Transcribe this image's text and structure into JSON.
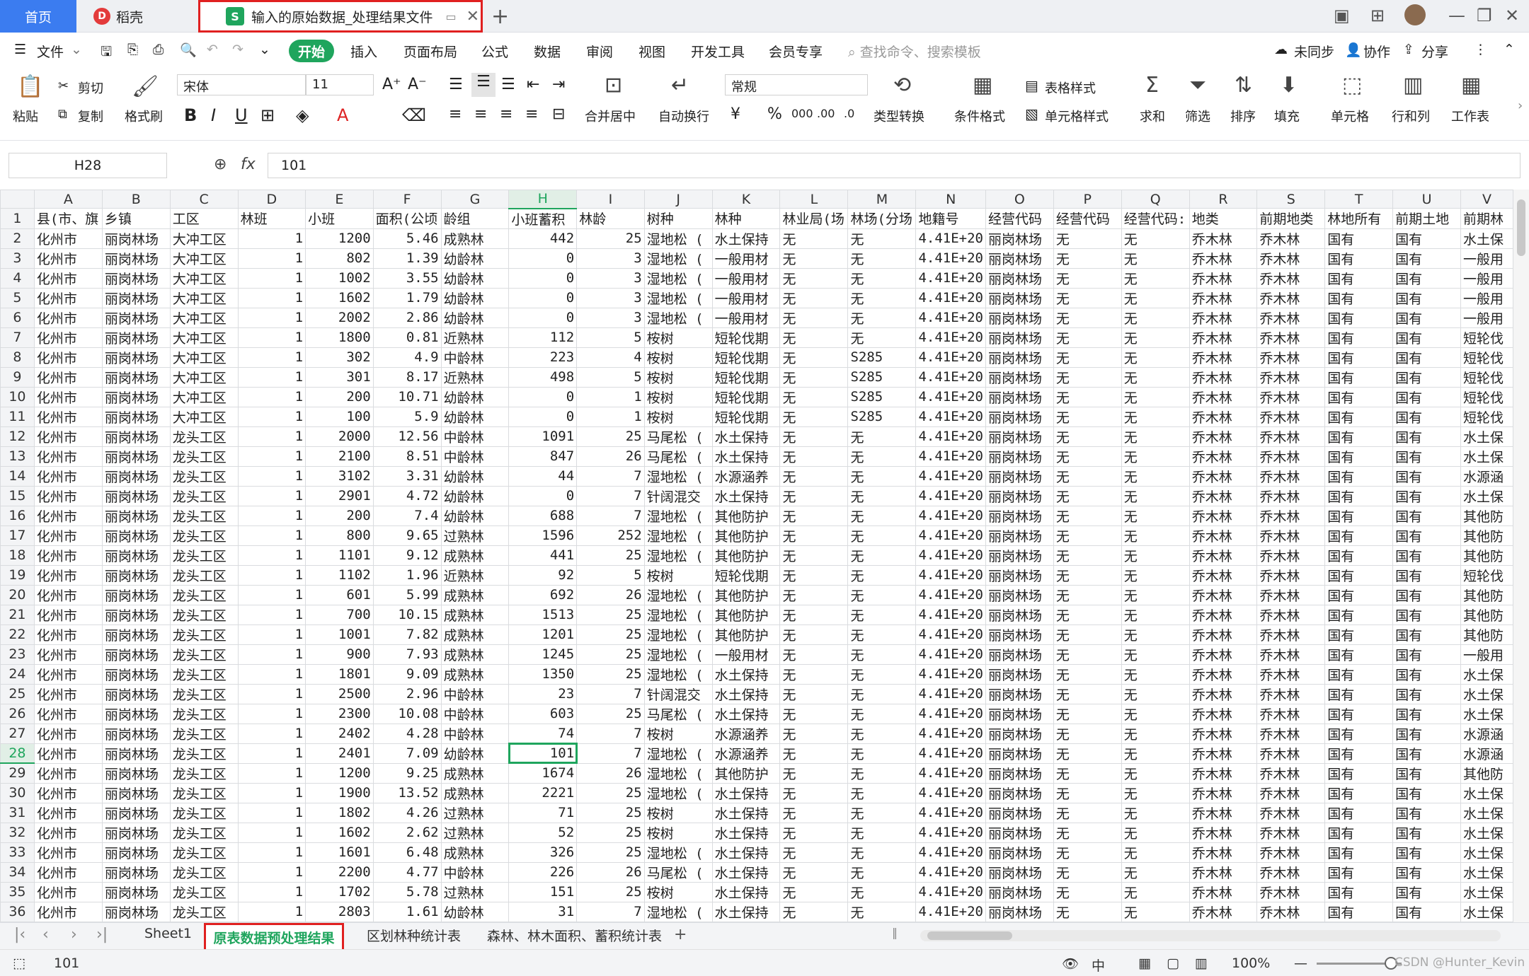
{
  "titlebar": {
    "home": "首页",
    "dk": "稻壳",
    "dk_logo": "D",
    "file_tab": "输入的原始数据_处理结果文件",
    "file_icon": "S",
    "add": "+",
    "pin_icon": "▭",
    "close_icon": "✕"
  },
  "menubar": {
    "file": "文件",
    "items": [
      "开始",
      "插入",
      "页面布局",
      "公式",
      "数据",
      "审阅",
      "视图",
      "开发工具",
      "会员专享"
    ],
    "search": "查找命令、搜索模板",
    "unsync": "未同步",
    "collab": "协作",
    "share": "分享"
  },
  "ribbon": {
    "paste": "粘贴",
    "cut": "剪切",
    "copy": "复制",
    "format_painter": "格式刷",
    "font_name": "宋体",
    "font_size": "11",
    "bold": "B",
    "italic": "I",
    "underline": "U",
    "merge": "合并居中",
    "wrap": "自动换行",
    "number_format": "常规",
    "currency": "¥",
    "percent": "%",
    "thousand": "000",
    "type_convert": "类型转换",
    "cond_format": "条件格式",
    "table_style": "表格样式",
    "cell_style": "单元格样式",
    "sum": "求和",
    "filter": "筛选",
    "sort": "排序",
    "fill": "填充",
    "cell": "单元格",
    "rowcol": "行和列",
    "worksheet": "工作表"
  },
  "formula": {
    "cell_ref": "H28",
    "fx": "fx",
    "value": "101"
  },
  "grid": {
    "columns": [
      "A",
      "B",
      "C",
      "D",
      "E",
      "F",
      "G",
      "H",
      "I",
      "J",
      "K",
      "L",
      "M",
      "N",
      "O",
      "P",
      "Q",
      "R",
      "S",
      "T",
      "U",
      "V"
    ],
    "selected_col": "H",
    "selected_row": "28",
    "header_row": [
      "县(市、旗",
      "乡镇",
      "工区",
      "林班",
      "小班",
      "面积(公顷",
      "龄组",
      "小班蓄积",
      "林龄",
      "树种",
      "林种",
      "林业局(场",
      "林场(分场",
      "地籍号",
      "经营代码",
      "经营代码",
      "经营代码:",
      "地类",
      "前期地类",
      "林地所有",
      "前期土地",
      "前期林"
    ],
    "rows": [
      [
        "2",
        "化州市",
        "丽岗林场",
        "大冲工区",
        "1",
        "1200",
        "5.46",
        "成熟林",
        "442",
        "25",
        "湿地松 (",
        "水土保持",
        "无",
        "无",
        "4.41E+20",
        "丽岗林场",
        "无",
        "无",
        "乔木林",
        "乔木林",
        "国有",
        "国有",
        "水土保"
      ],
      [
        "3",
        "化州市",
        "丽岗林场",
        "大冲工区",
        "1",
        "802",
        "1.39",
        "幼龄林",
        "0",
        "3",
        "湿地松 (",
        "一般用材",
        "无",
        "无",
        "4.41E+20",
        "丽岗林场",
        "无",
        "无",
        "乔木林",
        "乔木林",
        "国有",
        "国有",
        "一般用"
      ],
      [
        "4",
        "化州市",
        "丽岗林场",
        "大冲工区",
        "1",
        "1002",
        "3.55",
        "幼龄林",
        "0",
        "3",
        "湿地松 (",
        "一般用材",
        "无",
        "无",
        "4.41E+20",
        "丽岗林场",
        "无",
        "无",
        "乔木林",
        "乔木林",
        "国有",
        "国有",
        "一般用"
      ],
      [
        "5",
        "化州市",
        "丽岗林场",
        "大冲工区",
        "1",
        "1602",
        "1.79",
        "幼龄林",
        "0",
        "3",
        "湿地松 (",
        "一般用材",
        "无",
        "无",
        "4.41E+20",
        "丽岗林场",
        "无",
        "无",
        "乔木林",
        "乔木林",
        "国有",
        "国有",
        "一般用"
      ],
      [
        "6",
        "化州市",
        "丽岗林场",
        "大冲工区",
        "1",
        "2002",
        "2.86",
        "幼龄林",
        "0",
        "3",
        "湿地松 (",
        "一般用材",
        "无",
        "无",
        "4.41E+20",
        "丽岗林场",
        "无",
        "无",
        "乔木林",
        "乔木林",
        "国有",
        "国有",
        "一般用"
      ],
      [
        "7",
        "化州市",
        "丽岗林场",
        "大冲工区",
        "1",
        "1800",
        "0.81",
        "近熟林",
        "112",
        "5",
        "桉树",
        "短轮伐期",
        "无",
        "无",
        "4.41E+20",
        "丽岗林场",
        "无",
        "无",
        "乔木林",
        "乔木林",
        "国有",
        "国有",
        "短轮伐"
      ],
      [
        "8",
        "化州市",
        "丽岗林场",
        "大冲工区",
        "1",
        "302",
        "4.9",
        "中龄林",
        "223",
        "4",
        "桉树",
        "短轮伐期",
        "无",
        "S285",
        "4.41E+20",
        "丽岗林场",
        "无",
        "无",
        "乔木林",
        "乔木林",
        "国有",
        "国有",
        "短轮伐"
      ],
      [
        "9",
        "化州市",
        "丽岗林场",
        "大冲工区",
        "1",
        "301",
        "8.17",
        "近熟林",
        "498",
        "5",
        "桉树",
        "短轮伐期",
        "无",
        "S285",
        "4.41E+20",
        "丽岗林场",
        "无",
        "无",
        "乔木林",
        "乔木林",
        "国有",
        "国有",
        "短轮伐"
      ],
      [
        "10",
        "化州市",
        "丽岗林场",
        "大冲工区",
        "1",
        "200",
        "10.71",
        "幼龄林",
        "0",
        "1",
        "桉树",
        "短轮伐期",
        "无",
        "S285",
        "4.41E+20",
        "丽岗林场",
        "无",
        "无",
        "乔木林",
        "乔木林",
        "国有",
        "国有",
        "短轮伐"
      ],
      [
        "11",
        "化州市",
        "丽岗林场",
        "大冲工区",
        "1",
        "100",
        "5.9",
        "幼龄林",
        "0",
        "1",
        "桉树",
        "短轮伐期",
        "无",
        "S285",
        "4.41E+20",
        "丽岗林场",
        "无",
        "无",
        "乔木林",
        "乔木林",
        "国有",
        "国有",
        "短轮伐"
      ],
      [
        "12",
        "化州市",
        "丽岗林场",
        "龙头工区",
        "1",
        "2000",
        "12.56",
        "中龄林",
        "1091",
        "25",
        "马尾松 (",
        "水土保持",
        "无",
        "无",
        "4.41E+20",
        "丽岗林场",
        "无",
        "无",
        "乔木林",
        "乔木林",
        "国有",
        "国有",
        "水土保"
      ],
      [
        "13",
        "化州市",
        "丽岗林场",
        "龙头工区",
        "1",
        "2100",
        "8.51",
        "中龄林",
        "847",
        "26",
        "马尾松 (",
        "水土保持",
        "无",
        "无",
        "4.41E+20",
        "丽岗林场",
        "无",
        "无",
        "乔木林",
        "乔木林",
        "国有",
        "国有",
        "水土保"
      ],
      [
        "14",
        "化州市",
        "丽岗林场",
        "龙头工区",
        "1",
        "3102",
        "3.31",
        "幼龄林",
        "44",
        "7",
        "湿地松 (",
        "水源涵养",
        "无",
        "无",
        "4.41E+20",
        "丽岗林场",
        "无",
        "无",
        "乔木林",
        "乔木林",
        "国有",
        "国有",
        "水源涵"
      ],
      [
        "15",
        "化州市",
        "丽岗林场",
        "龙头工区",
        "1",
        "2901",
        "4.72",
        "幼龄林",
        "0",
        "7",
        "针阔混交",
        "水土保持",
        "无",
        "无",
        "4.41E+20",
        "丽岗林场",
        "无",
        "无",
        "乔木林",
        "乔木林",
        "国有",
        "国有",
        "水土保"
      ],
      [
        "16",
        "化州市",
        "丽岗林场",
        "龙头工区",
        "1",
        "200",
        "7.4",
        "幼龄林",
        "688",
        "7",
        "湿地松 (",
        "其他防护",
        "无",
        "无",
        "4.41E+20",
        "丽岗林场",
        "无",
        "无",
        "乔木林",
        "乔木林",
        "国有",
        "国有",
        "其他防"
      ],
      [
        "17",
        "化州市",
        "丽岗林场",
        "龙头工区",
        "1",
        "800",
        "9.65",
        "过熟林",
        "1596",
        "252",
        "湿地松 (",
        "其他防护",
        "无",
        "无",
        "4.41E+20",
        "丽岗林场",
        "无",
        "无",
        "乔木林",
        "乔木林",
        "国有",
        "国有",
        "其他防"
      ],
      [
        "18",
        "化州市",
        "丽岗林场",
        "龙头工区",
        "1",
        "1101",
        "9.12",
        "成熟林",
        "441",
        "25",
        "湿地松 (",
        "其他防护",
        "无",
        "无",
        "4.41E+20",
        "丽岗林场",
        "无",
        "无",
        "乔木林",
        "乔木林",
        "国有",
        "国有",
        "其他防"
      ],
      [
        "19",
        "化州市",
        "丽岗林场",
        "龙头工区",
        "1",
        "1102",
        "1.96",
        "近熟林",
        "92",
        "5",
        "桉树",
        "短轮伐期",
        "无",
        "无",
        "4.41E+20",
        "丽岗林场",
        "无",
        "无",
        "乔木林",
        "乔木林",
        "国有",
        "国有",
        "短轮伐"
      ],
      [
        "20",
        "化州市",
        "丽岗林场",
        "龙头工区",
        "1",
        "601",
        "5.99",
        "成熟林",
        "692",
        "26",
        "湿地松 (",
        "其他防护",
        "无",
        "无",
        "4.41E+20",
        "丽岗林场",
        "无",
        "无",
        "乔木林",
        "乔木林",
        "国有",
        "国有",
        "其他防"
      ],
      [
        "21",
        "化州市",
        "丽岗林场",
        "龙头工区",
        "1",
        "700",
        "10.15",
        "成熟林",
        "1513",
        "25",
        "湿地松 (",
        "其他防护",
        "无",
        "无",
        "4.41E+20",
        "丽岗林场",
        "无",
        "无",
        "乔木林",
        "乔木林",
        "国有",
        "国有",
        "其他防"
      ],
      [
        "22",
        "化州市",
        "丽岗林场",
        "龙头工区",
        "1",
        "1001",
        "7.82",
        "成熟林",
        "1201",
        "25",
        "湿地松 (",
        "其他防护",
        "无",
        "无",
        "4.41E+20",
        "丽岗林场",
        "无",
        "无",
        "乔木林",
        "乔木林",
        "国有",
        "国有",
        "其他防"
      ],
      [
        "23",
        "化州市",
        "丽岗林场",
        "龙头工区",
        "1",
        "900",
        "7.93",
        "成熟林",
        "1245",
        "25",
        "湿地松 (",
        "一般用材",
        "无",
        "无",
        "4.41E+20",
        "丽岗林场",
        "无",
        "无",
        "乔木林",
        "乔木林",
        "国有",
        "国有",
        "一般用"
      ],
      [
        "24",
        "化州市",
        "丽岗林场",
        "龙头工区",
        "1",
        "1801",
        "9.09",
        "成熟林",
        "1350",
        "25",
        "湿地松 (",
        "水土保持",
        "无",
        "无",
        "4.41E+20",
        "丽岗林场",
        "无",
        "无",
        "乔木林",
        "乔木林",
        "国有",
        "国有",
        "水土保"
      ],
      [
        "25",
        "化州市",
        "丽岗林场",
        "龙头工区",
        "1",
        "2500",
        "2.96",
        "中龄林",
        "23",
        "7",
        "针阔混交",
        "水土保持",
        "无",
        "无",
        "4.41E+20",
        "丽岗林场",
        "无",
        "无",
        "乔木林",
        "乔木林",
        "国有",
        "国有",
        "水土保"
      ],
      [
        "26",
        "化州市",
        "丽岗林场",
        "龙头工区",
        "1",
        "2300",
        "10.08",
        "中龄林",
        "603",
        "25",
        "马尾松 (",
        "水土保持",
        "无",
        "无",
        "4.41E+20",
        "丽岗林场",
        "无",
        "无",
        "乔木林",
        "乔木林",
        "国有",
        "国有",
        "水土保"
      ],
      [
        "27",
        "化州市",
        "丽岗林场",
        "龙头工区",
        "1",
        "2402",
        "4.28",
        "中龄林",
        "74",
        "7",
        "桉树",
        "水源涵养",
        "无",
        "无",
        "4.41E+20",
        "丽岗林场",
        "无",
        "无",
        "乔木林",
        "乔木林",
        "国有",
        "国有",
        "水源涵"
      ],
      [
        "28",
        "化州市",
        "丽岗林场",
        "龙头工区",
        "1",
        "2401",
        "7.09",
        "幼龄林",
        "101",
        "7",
        "湿地松 (",
        "水源涵养",
        "无",
        "无",
        "4.41E+20",
        "丽岗林场",
        "无",
        "无",
        "乔木林",
        "乔木林",
        "国有",
        "国有",
        "水源涵"
      ],
      [
        "29",
        "化州市",
        "丽岗林场",
        "龙头工区",
        "1",
        "1200",
        "9.25",
        "成熟林",
        "1674",
        "26",
        "湿地松 (",
        "其他防护",
        "无",
        "无",
        "4.41E+20",
        "丽岗林场",
        "无",
        "无",
        "乔木林",
        "乔木林",
        "国有",
        "国有",
        "其他防"
      ],
      [
        "30",
        "化州市",
        "丽岗林场",
        "龙头工区",
        "1",
        "1900",
        "13.52",
        "成熟林",
        "2221",
        "25",
        "湿地松 (",
        "水土保持",
        "无",
        "无",
        "4.41E+20",
        "丽岗林场",
        "无",
        "无",
        "乔木林",
        "乔木林",
        "国有",
        "国有",
        "水土保"
      ],
      [
        "31",
        "化州市",
        "丽岗林场",
        "龙头工区",
        "1",
        "1802",
        "4.26",
        "过熟林",
        "71",
        "25",
        "桉树",
        "水土保持",
        "无",
        "无",
        "4.41E+20",
        "丽岗林场",
        "无",
        "无",
        "乔木林",
        "乔木林",
        "国有",
        "国有",
        "水土保"
      ],
      [
        "32",
        "化州市",
        "丽岗林场",
        "龙头工区",
        "1",
        "1602",
        "2.62",
        "过熟林",
        "52",
        "25",
        "桉树",
        "水土保持",
        "无",
        "无",
        "4.41E+20",
        "丽岗林场",
        "无",
        "无",
        "乔木林",
        "乔木林",
        "国有",
        "国有",
        "水土保"
      ],
      [
        "33",
        "化州市",
        "丽岗林场",
        "龙头工区",
        "1",
        "1601",
        "6.48",
        "成熟林",
        "326",
        "25",
        "湿地松 (",
        "水土保持",
        "无",
        "无",
        "4.41E+20",
        "丽岗林场",
        "无",
        "无",
        "乔木林",
        "乔木林",
        "国有",
        "国有",
        "水土保"
      ],
      [
        "34",
        "化州市",
        "丽岗林场",
        "龙头工区",
        "1",
        "2200",
        "4.77",
        "中龄林",
        "226",
        "26",
        "马尾松 (",
        "水土保持",
        "无",
        "无",
        "4.41E+20",
        "丽岗林场",
        "无",
        "无",
        "乔木林",
        "乔木林",
        "国有",
        "国有",
        "水土保"
      ],
      [
        "35",
        "化州市",
        "丽岗林场",
        "龙头工区",
        "1",
        "1702",
        "5.78",
        "过熟林",
        "151",
        "25",
        "桉树",
        "水土保持",
        "无",
        "无",
        "4.41E+20",
        "丽岗林场",
        "无",
        "无",
        "乔木林",
        "乔木林",
        "国有",
        "国有",
        "水土保"
      ],
      [
        "36",
        "化州市",
        "丽岗林场",
        "龙头工区",
        "1",
        "2803",
        "1.61",
        "幼龄林",
        "31",
        "7",
        "湿地松 (",
        "水土保持",
        "无",
        "无",
        "4.41E+20",
        "丽岗林场",
        "无",
        "无",
        "乔木林",
        "乔木林",
        "国有",
        "国有",
        "水土保"
      ]
    ]
  },
  "sheet_tabs": [
    "Sheet1",
    "原表数据预处理结果",
    "区划林种统计表",
    "森林、林木面积、蓄积统计表"
  ],
  "active_sheet": "原表数据预处理结果",
  "status": {
    "cell_value": "101",
    "zoom": "100%",
    "watermark": "CSDN @Hunter_Kevin"
  },
  "colors": {
    "accent": "#1fa55d",
    "home_tab": "#3b7cf0",
    "highlight_border": "#e02020"
  }
}
